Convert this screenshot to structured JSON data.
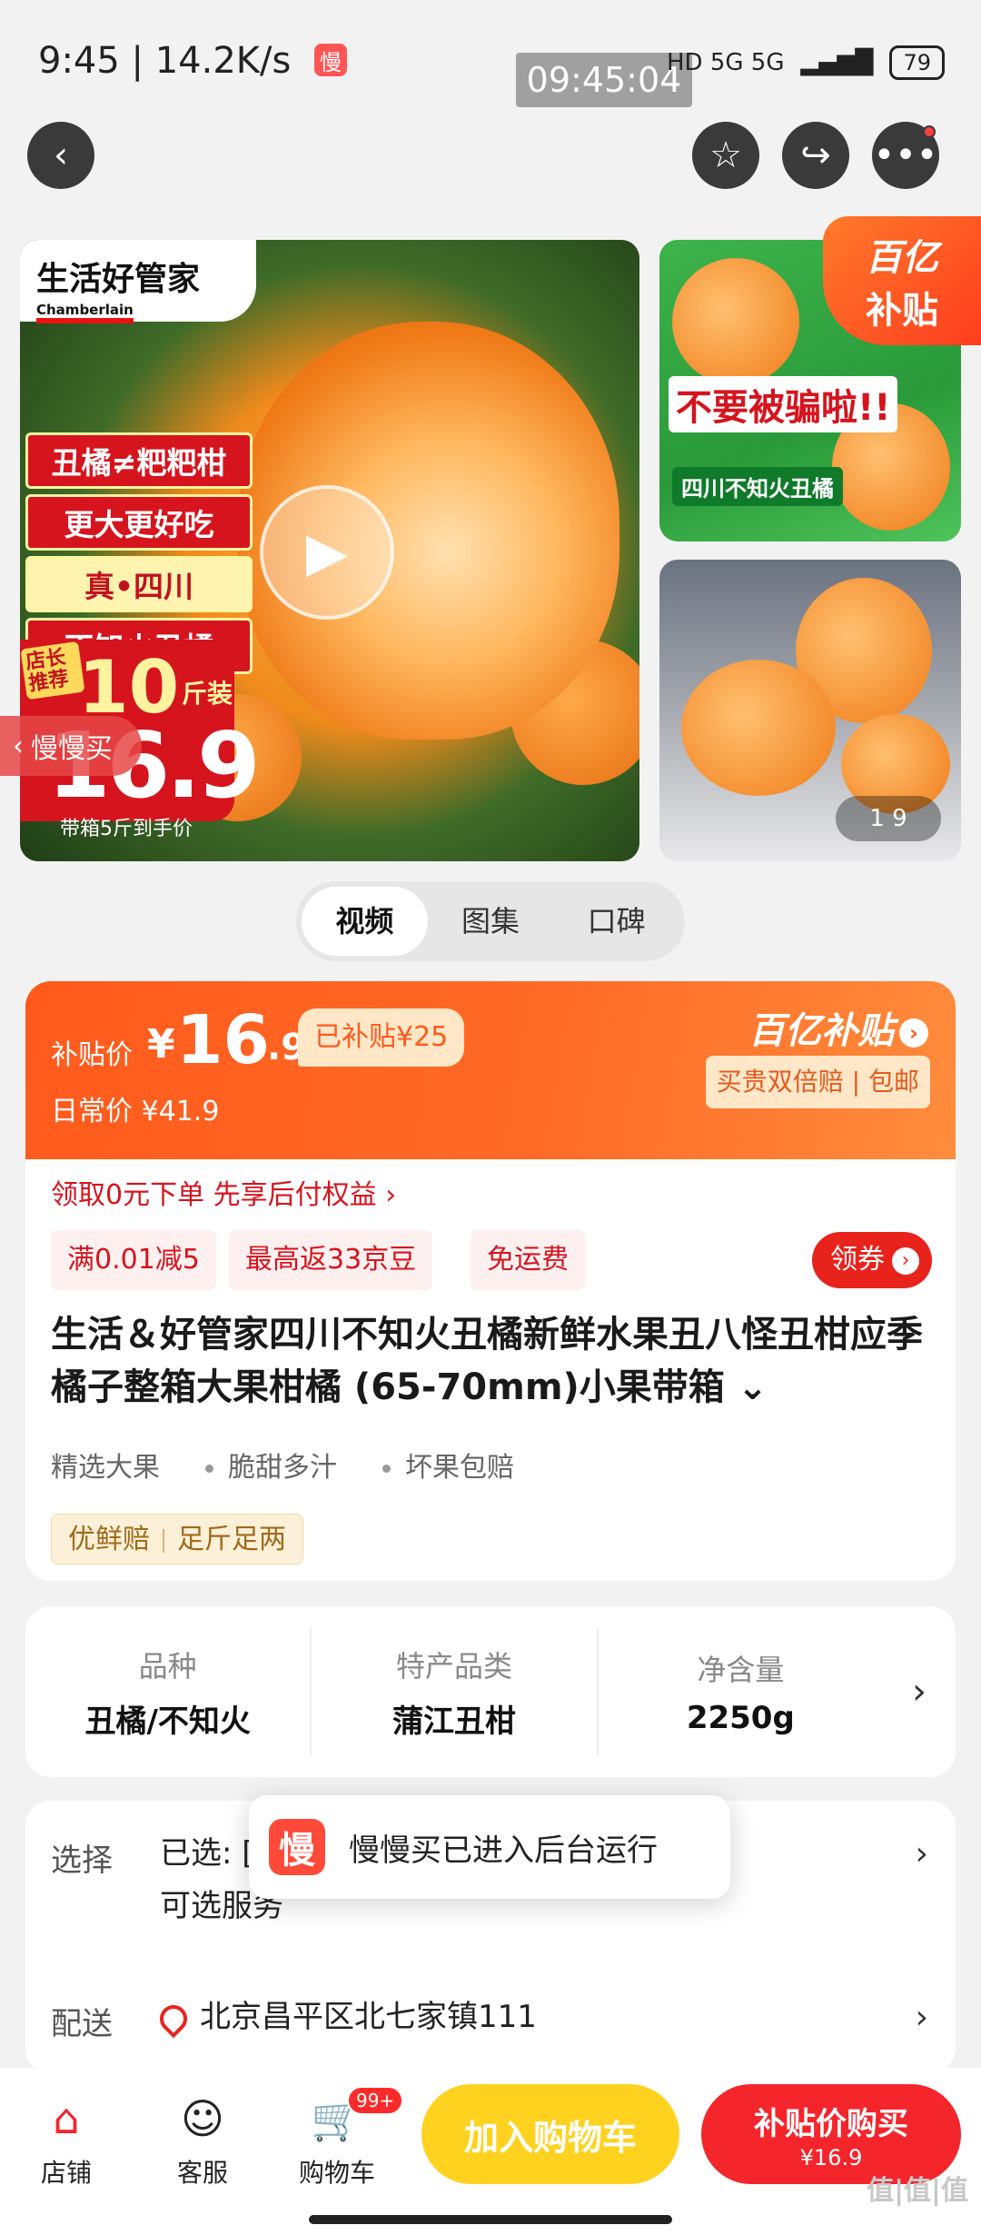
{
  "status_bar": {
    "time": "9:45 | 14.2K/s",
    "app_badge": "慢",
    "overlay_clock": "09:45:04",
    "network": "HD 5G 5G",
    "battery": "79"
  },
  "nav": {
    "back_icon": "back-arrow-icon",
    "favorite_icon": "star-icon",
    "share_icon": "share-icon",
    "more_icon": "more-dots-icon"
  },
  "gallery": {
    "brand_cn": "生活好管家",
    "brand_en": "Chamberlain",
    "promo_lines": [
      "丑橘≠粑粑柑",
      "更大更好吃",
      "真•四川",
      "不知火丑橘"
    ],
    "shop_tag": "店长推荐",
    "weight": "10",
    "weight_unit": "斤装",
    "price": "16.9",
    "price_sub": "带箱5斤到手价",
    "slow_buy_label": "慢慢买",
    "side1_banner": "不要被骗啦!!",
    "side1_small": "四川不知火丑橘",
    "subsidy_corner_top": "百亿",
    "subsidy_corner_bottom": "补贴",
    "counter": "1 9"
  },
  "media_tabs": [
    "视频",
    "图集",
    "口碑"
  ],
  "price": {
    "label": "补贴价",
    "currency": "¥",
    "integer": "16",
    "decimal": ".9",
    "subsidized": "已补贴¥25",
    "daily": "日常价 ¥41.9",
    "brand": "百亿补贴",
    "guarantee": "买贵双倍赔 | 包邮"
  },
  "pay_later": "领取0元下单 先享后付权益 ›",
  "coupons": [
    "满0.01减5",
    "最高返33京豆",
    "免运费"
  ],
  "get_coupon": "领券",
  "title": "生活＆好管家四川不知火丑橘新鲜水果丑八怪丑柑应季橘子整箱大果柑橘 (65-70mm)小果带箱 ⌄",
  "features": [
    "精选大果",
    "脆甜多汁",
    "坏果包赔"
  ],
  "fresh_badge": [
    "优鲜赔",
    "足斤足两"
  ],
  "specs": [
    {
      "label": "品种",
      "value": "丑橘/不知火"
    },
    {
      "label": "特产品类",
      "value": "蒲江丑柑"
    },
    {
      "label": "净含量",
      "value": "2250g"
    }
  ],
  "select": {
    "label": "选择",
    "value_line1": "已选: [                                      果], 1件,",
    "value_line2": "可选服务"
  },
  "delivery": {
    "label": "配送",
    "address": "北京昌平区北七家镇111"
  },
  "toast": {
    "icon": "慢",
    "text": "慢慢买已进入后台运行"
  },
  "bottom_bar": {
    "shop": "店铺",
    "service": "客服",
    "cart": "购物车",
    "cart_badge": "99+",
    "add_to_cart": "加入购物车",
    "buy_main": "补贴价购买",
    "buy_sub": "¥16.9"
  },
  "watermark": "值|值|值"
}
